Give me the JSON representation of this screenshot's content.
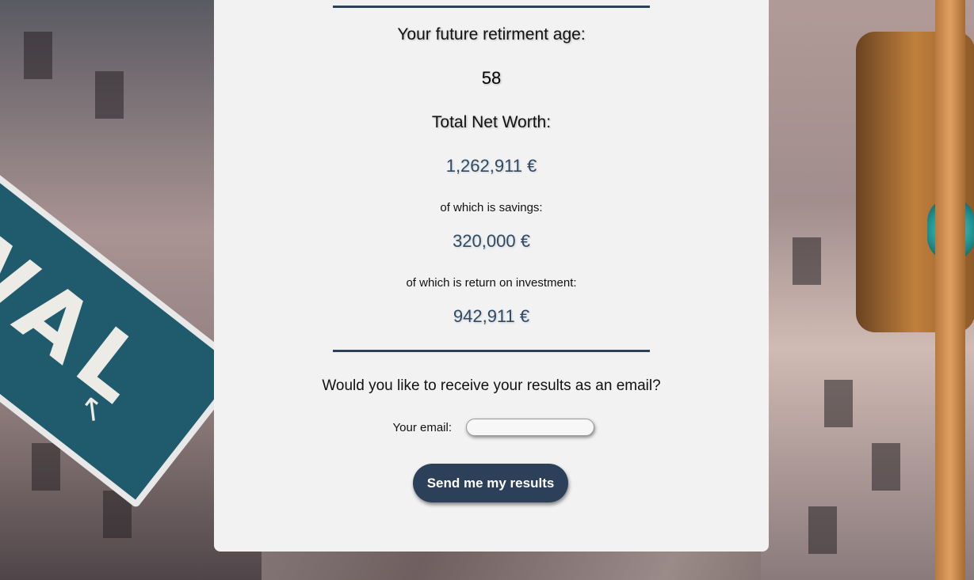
{
  "results": {
    "retirement_age_heading": "Your future retirment age:",
    "retirement_age_value": "58",
    "net_worth_heading": "Total Net Worth:",
    "net_worth_value": "1,262,911 €",
    "savings_heading": "of which is savings:",
    "savings_value": "320,000 €",
    "roi_heading": "of which is return on investment:",
    "roi_value": "942,911 €"
  },
  "email_form": {
    "question": "Would you like to receive your results as an email?",
    "email_label": "Your email:",
    "email_value": "",
    "email_placeholder": "",
    "send_button_label": "Send me my results"
  },
  "background": {
    "sign_text": "WAL",
    "sign_arrow_icon": "arrow-up-left-icon"
  },
  "colors": {
    "accent": "#2c4159",
    "money_text": "#2d4a66",
    "panel_bg": "#f2f2f2"
  }
}
